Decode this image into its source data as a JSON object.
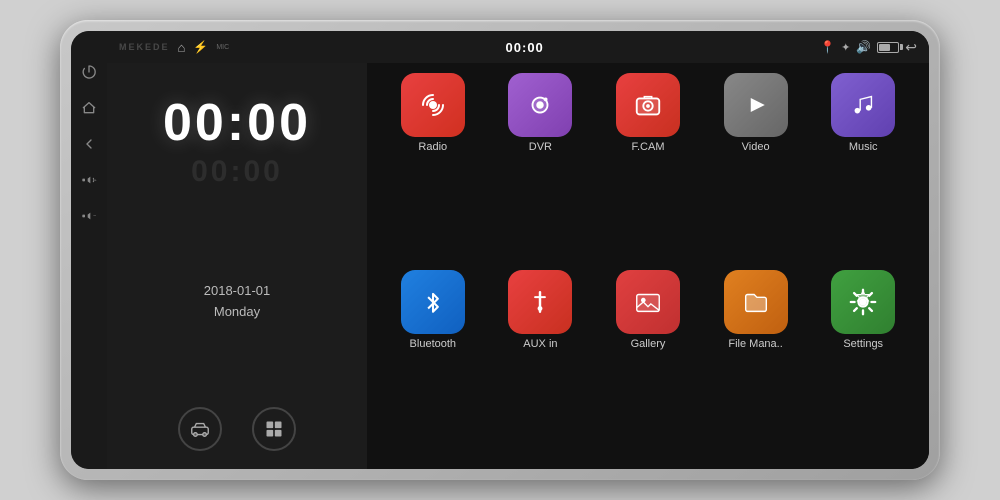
{
  "device": {
    "watermark": "MEKEDE",
    "mic_label": "MIC"
  },
  "status_bar": {
    "time": "00:00",
    "left_icons": [
      "home",
      "usb"
    ],
    "right_icons": [
      "location",
      "bluetooth",
      "volume",
      "battery",
      "back"
    ]
  },
  "clock_panel": {
    "time": "00:00",
    "date": "2018-01-01",
    "day": "Monday"
  },
  "side_buttons": [
    {
      "name": "power",
      "symbol": "⏻"
    },
    {
      "name": "home",
      "symbol": "⌂"
    },
    {
      "name": "back",
      "symbol": "↩"
    },
    {
      "name": "vol-up",
      "symbol": "+"
    },
    {
      "name": "vol-down",
      "symbol": "−"
    }
  ],
  "apps": [
    {
      "id": "radio",
      "label": "Radio",
      "icon_class": "icon-radio",
      "symbol": "📡"
    },
    {
      "id": "dvr",
      "label": "DVR",
      "icon_class": "icon-dvr",
      "symbol": "📷"
    },
    {
      "id": "fcam",
      "label": "F.CAM",
      "icon_class": "icon-fcam",
      "symbol": "📸"
    },
    {
      "id": "video",
      "label": "Video",
      "icon_class": "icon-video",
      "symbol": "▶"
    },
    {
      "id": "music",
      "label": "Music",
      "icon_class": "icon-music",
      "symbol": "♪"
    },
    {
      "id": "bluetooth",
      "label": "Bluetooth",
      "icon_class": "icon-bt",
      "symbol": "⦿"
    },
    {
      "id": "aux",
      "label": "AUX in",
      "icon_class": "icon-aux",
      "symbol": "🎵"
    },
    {
      "id": "gallery",
      "label": "Gallery",
      "icon_class": "icon-gallery",
      "symbol": "🖼"
    },
    {
      "id": "fileman",
      "label": "File Mana..",
      "icon_class": "icon-fileman",
      "symbol": "📁"
    },
    {
      "id": "settings",
      "label": "Settings",
      "icon_class": "icon-settings",
      "symbol": "⚙"
    }
  ],
  "bottom_icons": [
    {
      "name": "drive-mode",
      "symbol": "🚗"
    },
    {
      "name": "grid-view",
      "symbol": "⊞"
    }
  ]
}
